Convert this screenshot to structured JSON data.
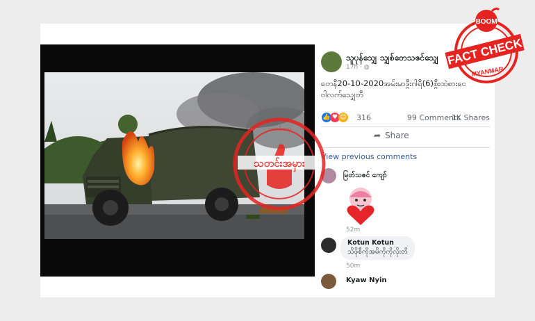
{
  "post": {
    "author": "သူပုန်သျှေ သျှစ်တေသဇင်သျှေ",
    "time": "17h · ",
    "text_line1": "တေနီ20-10-2020အမ်းမာဒွီးဂါရီ(6)စွီးထဲစားငေ",
    "text_line2": "ဝါလက်သျှေတီ",
    "reaction_count": "316",
    "comments_count": "99 Comments",
    "shares_count": "1K Shares",
    "share_label": "Share",
    "view_previous": "View previous comments"
  },
  "comments": [
    {
      "author": "မြတ်သဇင် ကျော်",
      "text": "",
      "time": "52m"
    },
    {
      "author": "Kotun Kotun",
      "text": "သိဖိုစီကိုအမိကိုကိုလိုးတိ",
      "time": "50m"
    },
    {
      "author": "Kyaw Nyin",
      "text": "",
      "time": ""
    }
  ],
  "boom_badge": {
    "brand": "BOOM",
    "label": "FACT CHECK",
    "region": "MYANMAR",
    "color": "#e52421"
  },
  "stamp": {
    "main_text": "သတင်းအမှား",
    "ring_text": "သတင်းအမှ",
    "color": "#e52421"
  },
  "colors": {
    "link": "#385898",
    "like": "#1877f2",
    "love": "#f33e58",
    "haha": "#f7b125"
  }
}
